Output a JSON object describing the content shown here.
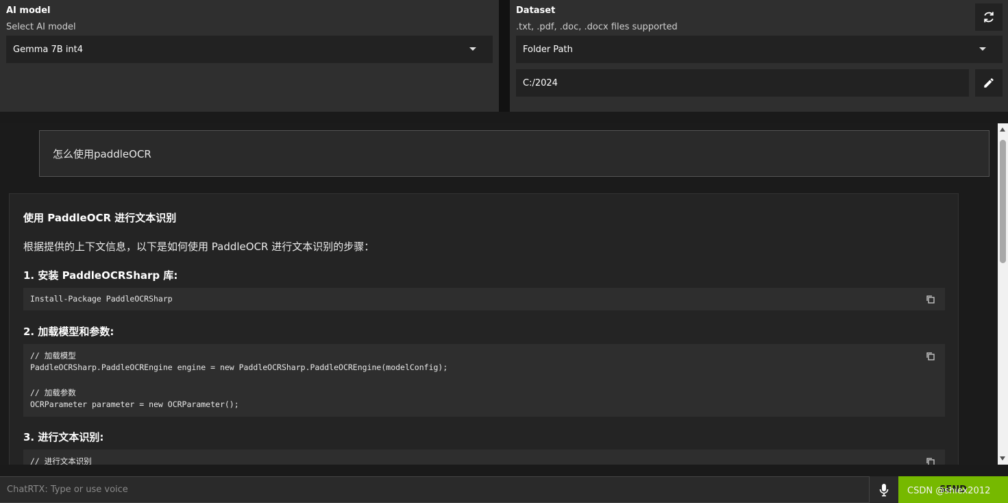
{
  "model_panel": {
    "title": "AI model",
    "subtitle": "Select AI model",
    "selected": "Gemma 7B int4"
  },
  "dataset_panel": {
    "title": "Dataset",
    "subtitle": ".txt, .pdf, .doc, .docx files supported",
    "source_selected": "Folder Path",
    "path_value": "C:/2024"
  },
  "chat": {
    "user_message": "怎么使用paddleOCR",
    "answer": {
      "heading": "使用 PaddleOCR 进行文本识别",
      "intro": "根据提供的上下文信息，以下是如何使用 PaddleOCR 进行文本识别的步骤：",
      "step1_title": "1. 安装 PaddleOCRSharp 库:",
      "step1_code": "Install-Package PaddleOCRSharp",
      "step2_title": "2. 加载模型和参数:",
      "step2_code_lines": [
        "// 加载模型",
        "PaddleOCRSharp.PaddleOCREngine engine = new PaddleOCRSharp.PaddleOCREngine(modelConfig);",
        "",
        "// 加载参数",
        "OCRParameter parameter = new OCRParameter();"
      ],
      "step3_title": "3. 进行文本识别:",
      "step3_code_lines": [
        "// 进行文本识别"
      ]
    }
  },
  "input": {
    "placeholder": "ChatRTX: Type or use voice",
    "send_label": "SEND"
  },
  "watermark": "CSDN @shiex2012",
  "colors": {
    "accent": "#76b900",
    "panel_bg": "#2f2f2f",
    "field_bg": "#222222",
    "code_bg": "#2e2e2e"
  },
  "icons": [
    "refresh-icon",
    "pencil-icon",
    "copy-icon",
    "microphone-icon",
    "caret-down-icon"
  ]
}
